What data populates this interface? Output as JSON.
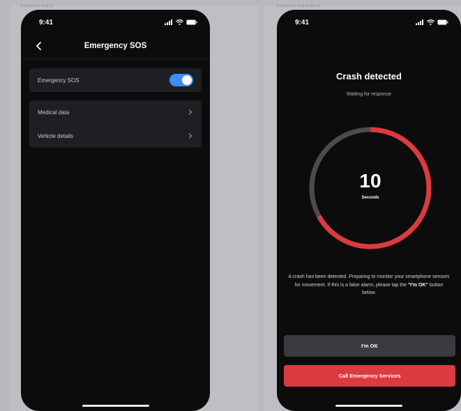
{
  "frames": {
    "left_label": "Emergency SOS UI",
    "right_label": "Emergency SOS Active UI"
  },
  "status_bar": {
    "time": "9:41"
  },
  "settings_screen": {
    "title": "Emergency SOS",
    "toggle_row": {
      "label": "Emergency SOS",
      "enabled": true
    },
    "rows": [
      {
        "label": "Medical data"
      },
      {
        "label": "Vehicle details"
      }
    ]
  },
  "crash_screen": {
    "title": "Crash detected",
    "subtitle": "Waiting for response",
    "countdown": {
      "value": "10",
      "unit": "Seconds",
      "progress_fraction": 0.67
    },
    "message_before": "A crash has been detected. Preparing to monitor your smartphone sensors for movement. If this is a false alarm, please tap the ",
    "message_emphasis": "\"I'm OK\"",
    "message_after": " button below.",
    "ok_button": "I'm OK",
    "call_button": "Call Emergency Services"
  },
  "colors": {
    "screen_bg": "#0c0c0d",
    "card_bg": "#1f1f23",
    "toggle_on": "#3e8ef7",
    "alert_red": "#dd3a3f",
    "ring_track": "#4a4a50",
    "ok_button_bg": "#3a3a3f"
  },
  "icons": {
    "back": "chevron-left-icon",
    "row_arrow": "chevron-right-icon",
    "signal": "cellular-signal-icon",
    "wifi": "wifi-icon",
    "battery": "battery-icon"
  }
}
